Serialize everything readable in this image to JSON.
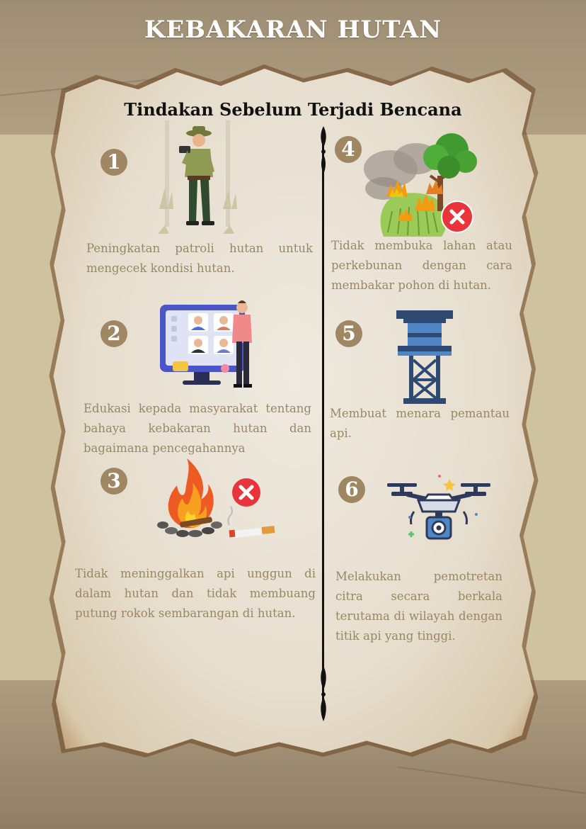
{
  "header": {
    "title": "KEBAKARAN HUTAN"
  },
  "subtitle": "Tindakan Sebelum Terjadi Bencana",
  "items": [
    {
      "number": "1",
      "text": "Peningkatan patroli hutan untuk mengecek kondisi hutan.",
      "icon": "forest-ranger-icon"
    },
    {
      "number": "2",
      "text": "Edukasi kepada masyarakat tentang bahaya kebakaran hutan dan bagaimana pencegahannya",
      "icon": "video-conference-icon"
    },
    {
      "number": "3",
      "text": "Tidak meninggalkan api unggun di dalam hutan dan tidak membuang putung rokok sembarangan di hutan.",
      "icon": "campfire-cigarette-icon"
    },
    {
      "number": "4",
      "text": "Tidak membuka lahan atau perkebunan dengan cara membakar pohon di hutan.",
      "icon": "burning-forest-icon"
    },
    {
      "number": "5",
      "text": "Membuat menara pemantau api.",
      "icon": "watch-tower-icon"
    },
    {
      "number": "6",
      "text": "Melakukan pemotretan citra secara berkala terutama di wilayah dengan titik api yang tinggi.",
      "icon": "camera-drone-icon"
    }
  ],
  "colors": {
    "badge": "#9e8762",
    "body_text": "#9a8764",
    "paper": "#ebe4d6",
    "background": "#b4a48a",
    "prohibited": "#e8343a"
  }
}
